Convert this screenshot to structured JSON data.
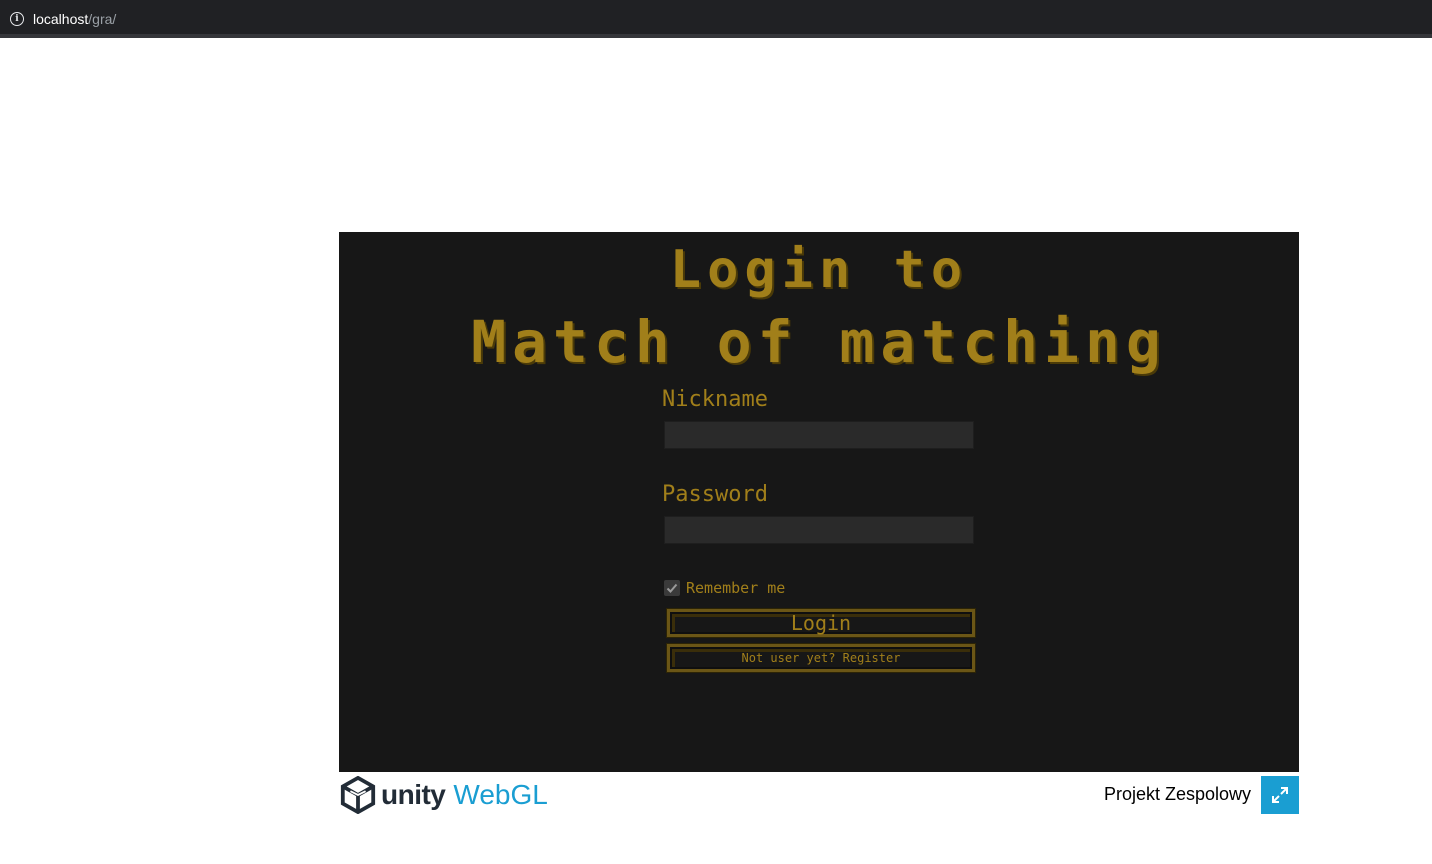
{
  "browser": {
    "url_host": "localhost",
    "url_path": "/gra/",
    "info_icon": "info-icon"
  },
  "game": {
    "title_line1": "Login to",
    "title_line2": "Match of matching",
    "nickname_label": "Nickname",
    "nickname_value": "",
    "password_label": "Password",
    "password_value": "",
    "remember_label": "Remember me",
    "remember_checked": true,
    "login_button": "Login",
    "register_button": "Not user yet? Register"
  },
  "footer": {
    "unity_label": "unity",
    "webgl_label": "WebGL",
    "project_title": "Projekt Zespolowy",
    "fullscreen_icon": "fullscreen-icon"
  },
  "colors": {
    "canvas_bg": "#171717",
    "game_gold": "#a17f1a",
    "webgl_blue": "#1a9ed2",
    "unity_dark": "#222c37"
  }
}
